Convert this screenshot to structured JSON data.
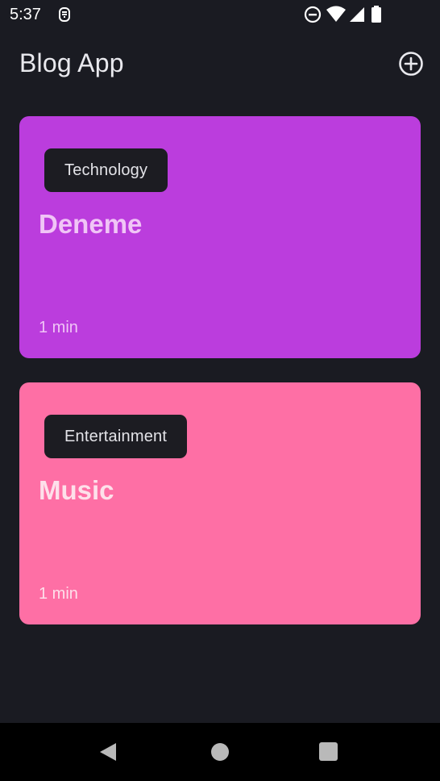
{
  "status_bar": {
    "time": "5:37",
    "icons": [
      "notification-icon",
      "do-not-disturb-icon",
      "wifi-icon",
      "signal-icon",
      "battery-icon"
    ]
  },
  "app_bar": {
    "title": "Blog App",
    "add_icon": "add-circle-icon"
  },
  "posts": [
    {
      "category": "Technology",
      "title": "Deneme",
      "read_time": "1 min",
      "color": "#bb3ddd",
      "text_color": "#f0c5f6"
    },
    {
      "category": "Entertainment",
      "title": "Music",
      "read_time": "1 min",
      "color": "#fe6fa5",
      "text_color": "#fde0ea"
    }
  ],
  "nav_bar": {
    "icons": [
      "back-icon",
      "home-icon",
      "recents-icon"
    ]
  },
  "colors": {
    "background": "#1a1b22",
    "chip_background": "#1c1c22"
  }
}
